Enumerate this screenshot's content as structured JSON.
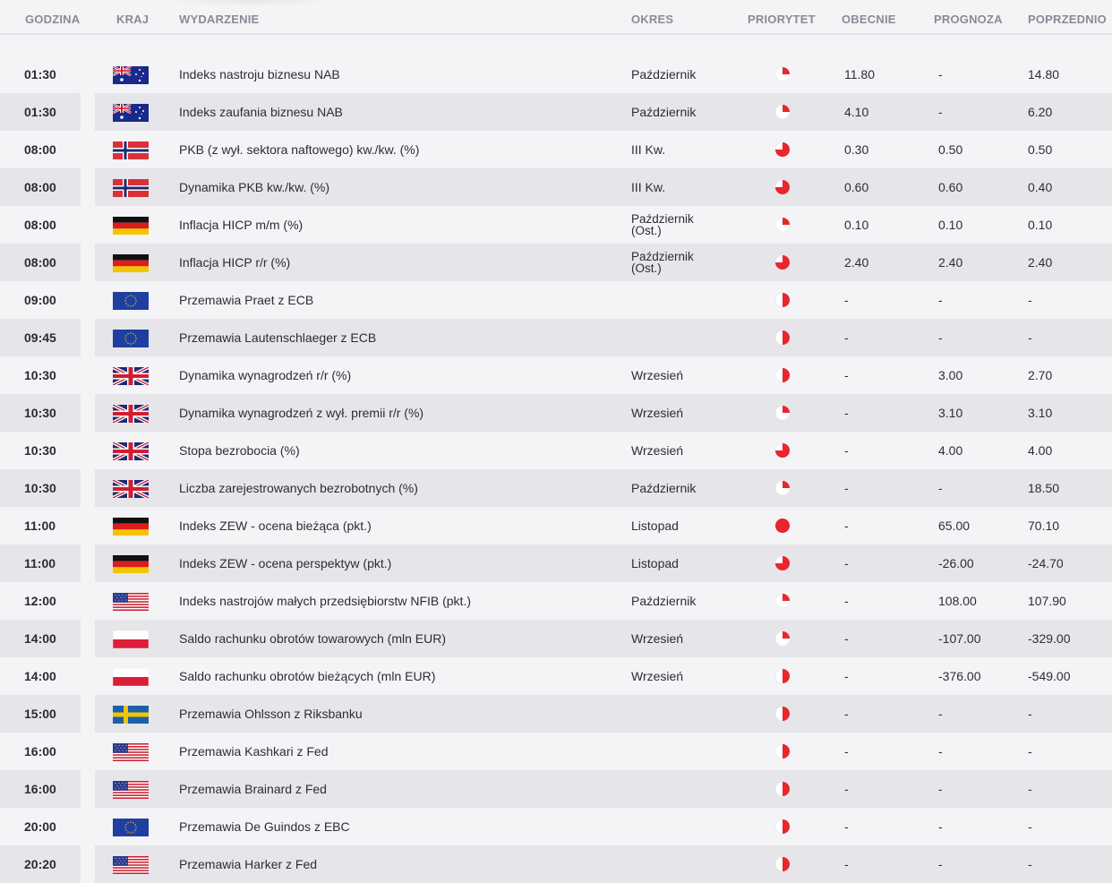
{
  "columns": {
    "time": "GODZINA",
    "country": "KRAJ",
    "event": "WYDARZENIE",
    "period": "OKRES",
    "priority": "PRIORYTET",
    "current": "OBECNIE",
    "forecast": "PROGNOZA",
    "previous": "POPRZEDNIO"
  },
  "priority_icons": {
    "quarter": "priority-low-icon",
    "three-quarter": "priority-high-icon",
    "full": "priority-max-icon",
    "half": "priority-medium-icon"
  },
  "colors": {
    "priority": "#e8262d",
    "alt_row": "#e6e6ea"
  },
  "rows": [
    {
      "time": "01:30",
      "country": "AU",
      "flag": "australia-flag-icon",
      "event": "Indeks nastroju biznesu NAB",
      "period": "Październik",
      "priority": "quarter",
      "current": "11.80",
      "forecast": "-",
      "previous": "14.80"
    },
    {
      "time": "01:30",
      "country": "AU",
      "flag": "australia-flag-icon",
      "event": "Indeks zaufania biznesu NAB",
      "period": "Październik",
      "priority": "quarter",
      "current": "4.10",
      "forecast": "-",
      "previous": "6.20"
    },
    {
      "time": "08:00",
      "country": "NO",
      "flag": "norway-flag-icon",
      "event": "PKB (z wył. sektora naftowego) kw./kw. (%)",
      "period": "III Kw.",
      "priority": "three-quarter",
      "current": "0.30",
      "forecast": "0.50",
      "previous": "0.50"
    },
    {
      "time": "08:00",
      "country": "NO",
      "flag": "norway-flag-icon",
      "event": "Dynamika PKB kw./kw. (%)",
      "period": "III Kw.",
      "priority": "three-quarter",
      "current": "0.60",
      "forecast": "0.60",
      "previous": "0.40"
    },
    {
      "time": "08:00",
      "country": "DE",
      "flag": "germany-flag-icon",
      "event": "Inflacja HICP m/m (%)",
      "period": "Październik (Ost.)",
      "period1": "Październik",
      "period2": "(Ost.)",
      "priority": "quarter",
      "current": "0.10",
      "forecast": "0.10",
      "previous": "0.10"
    },
    {
      "time": "08:00",
      "country": "DE",
      "flag": "germany-flag-icon",
      "event": "Inflacja HICP r/r (%)",
      "period": "Październik (Ost.)",
      "period1": "Październik",
      "period2": "(Ost.)",
      "priority": "three-quarter",
      "current": "2.40",
      "forecast": "2.40",
      "previous": "2.40"
    },
    {
      "time": "09:00",
      "country": "EU",
      "flag": "eu-flag-icon",
      "event": "Przemawia Praet z ECB",
      "period": "",
      "priority": "half",
      "current": "-",
      "forecast": "-",
      "previous": "-"
    },
    {
      "time": "09:45",
      "country": "EU",
      "flag": "eu-flag-icon",
      "event": "Przemawia Lautenschlaeger z ECB",
      "period": "",
      "priority": "half",
      "current": "-",
      "forecast": "-",
      "previous": "-"
    },
    {
      "time": "10:30",
      "country": "GB",
      "flag": "uk-flag-icon",
      "event": "Dynamika wynagrodzeń r/r (%)",
      "period": "Wrzesień",
      "priority": "half",
      "current": "-",
      "forecast": "3.00",
      "previous": "2.70"
    },
    {
      "time": "10:30",
      "country": "GB",
      "flag": "uk-flag-icon",
      "event": "Dynamika wynagrodzeń z wył. premii r/r (%)",
      "period": "Wrzesień",
      "priority": "quarter",
      "current": "-",
      "forecast": "3.10",
      "previous": "3.10"
    },
    {
      "time": "10:30",
      "country": "GB",
      "flag": "uk-flag-icon",
      "event": "Stopa bezrobocia (%)",
      "period": "Wrzesień",
      "priority": "three-quarter",
      "current": "-",
      "forecast": "4.00",
      "previous": "4.00"
    },
    {
      "time": "10:30",
      "country": "GB",
      "flag": "uk-flag-icon",
      "event": "Liczba zarejestrowanych bezrobotnych (%)",
      "period": "Październik",
      "priority": "quarter",
      "current": "-",
      "forecast": "-",
      "previous": "18.50"
    },
    {
      "time": "11:00",
      "country": "DE",
      "flag": "germany-flag-icon",
      "event": "Indeks ZEW - ocena bieżąca (pkt.)",
      "period": "Listopad",
      "priority": "full",
      "current": "-",
      "forecast": "65.00",
      "previous": "70.10"
    },
    {
      "time": "11:00",
      "country": "DE",
      "flag": "germany-flag-icon",
      "event": "Indeks ZEW - ocena perspektyw (pkt.)",
      "period": "Listopad",
      "priority": "three-quarter",
      "current": "-",
      "forecast": "-26.00",
      "previous": "-24.70"
    },
    {
      "time": "12:00",
      "country": "US",
      "flag": "usa-flag-icon",
      "event": "Indeks nastrojów małych przedsiębiorstw NFIB (pkt.)",
      "period": "Październik",
      "priority": "quarter",
      "current": "-",
      "forecast": "108.00",
      "previous": "107.90"
    },
    {
      "time": "14:00",
      "country": "PL",
      "flag": "poland-flag-icon",
      "event": "Saldo rachunku obrotów towarowych (mln EUR)",
      "period": "Wrzesień",
      "priority": "quarter",
      "current": "-",
      "forecast": "-107.00",
      "previous": "-329.00"
    },
    {
      "time": "14:00",
      "country": "PL",
      "flag": "poland-flag-icon",
      "event": "Saldo rachunku obrotów bieżących (mln EUR)",
      "period": "Wrzesień",
      "priority": "half",
      "current": "-",
      "forecast": "-376.00",
      "previous": "-549.00"
    },
    {
      "time": "15:00",
      "country": "SE",
      "flag": "sweden-flag-icon",
      "event": "Przemawia Ohlsson z Riksbanku",
      "period": "",
      "priority": "half",
      "current": "-",
      "forecast": "-",
      "previous": "-"
    },
    {
      "time": "16:00",
      "country": "US",
      "flag": "usa-flag-icon",
      "event": "Przemawia Kashkari z Fed",
      "period": "",
      "priority": "half",
      "current": "-",
      "forecast": "-",
      "previous": "-"
    },
    {
      "time": "16:00",
      "country": "US",
      "flag": "usa-flag-icon",
      "event": "Przemawia Brainard z Fed",
      "period": "",
      "priority": "half",
      "current": "-",
      "forecast": "-",
      "previous": "-"
    },
    {
      "time": "20:00",
      "country": "EU",
      "flag": "eu-flag-icon",
      "event": "Przemawia De Guindos z EBC",
      "period": "",
      "priority": "half",
      "current": "-",
      "forecast": "-",
      "previous": "-"
    },
    {
      "time": "20:20",
      "country": "US",
      "flag": "usa-flag-icon",
      "event": "Przemawia Harker z Fed",
      "period": "",
      "priority": "half",
      "current": "-",
      "forecast": "-",
      "previous": "-"
    }
  ]
}
